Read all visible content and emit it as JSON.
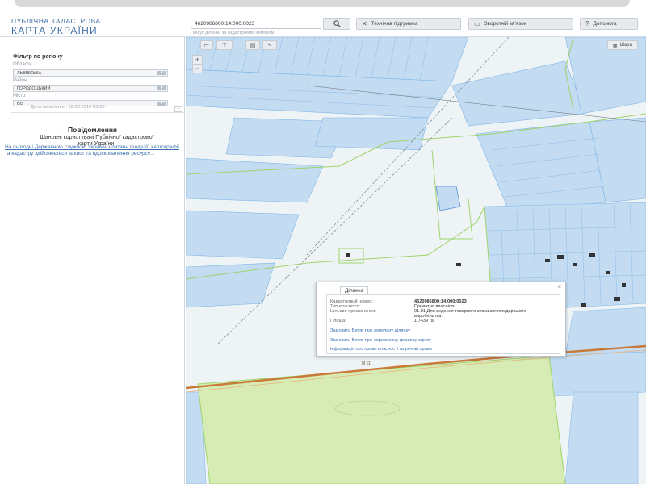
{
  "header": {
    "logo_top": "ПУБЛІЧНА КАДАСТРОВА",
    "logo_bottom": "КАРТА УКРАЇНИ",
    "search_value": "4620986800:14:000:0023",
    "search_hint": "Пошук ділянки за кадастровим номером",
    "buttons": [
      {
        "label": "Технічна підтримка",
        "icon": "tools-icon"
      },
      {
        "label": "Зворотній зв'язок",
        "icon": "chat-icon"
      },
      {
        "label": "Допомога",
        "icon": "help-icon"
      }
    ]
  },
  "sidebar": {
    "filter_title": "Фільтр по регіону",
    "region_label": "Область",
    "region_value": "ЛЬВІВСЬКА",
    "district_label": "Район",
    "district_value": "ГОРОДОЦЬКИЙ",
    "city_label": "Місто",
    "city_value": "Всі",
    "update_date": "Дата оновлення: 12.06.2016 03:00",
    "notice_title": "Повідомлення",
    "notice_text": "Шановні користувачі Публічної кадастрової карти України!",
    "notice_link": "На сьогодні Державною службою України з питань геодезії, картографії та кадастру здійснюється захист та вдосконалення ресурсу..."
  },
  "map": {
    "layers_label": "Шари",
    "road_label": "М 11",
    "popup": {
      "tab": "Ділянка",
      "rows": [
        {
          "k": "Кадастровий номер:",
          "v": "4620986800:14:000:0023"
        },
        {
          "k": "Тип власності:",
          "v": "Приватна власність"
        },
        {
          "k": "Цільове призначення:",
          "v": "01.01 Для ведення товарного сільськогосподарського виробництва"
        },
        {
          "k": "Площа:",
          "v": "1.7439 га"
        }
      ],
      "links": [
        "Замовити Витяг про земельну ділянку",
        "Замовити Витяг про нормативну грошову оцінку",
        "Інформація про право власності та речові права"
      ]
    }
  },
  "colors": {
    "accent": "#3d6ea5",
    "parcel_fill": "#c3dcf2",
    "parcel_stroke": "#7fb4e6",
    "boundary": "#9ed36a",
    "field_green": "#d6ecb4",
    "road": "#c97a3a"
  }
}
